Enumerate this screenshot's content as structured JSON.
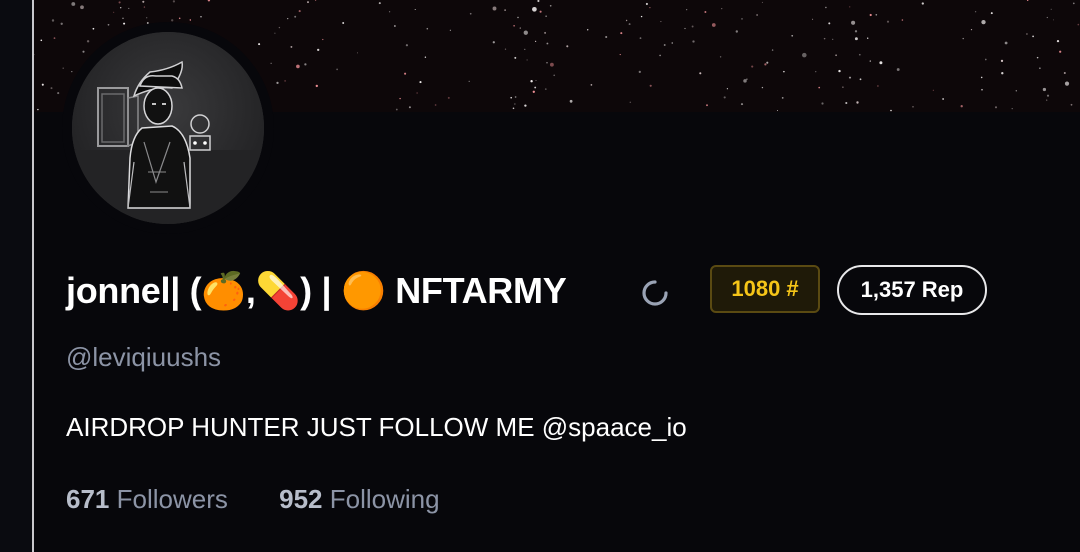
{
  "profile": {
    "display_name": "jonnel| (🍊,💊) | 🟠 NFTARMY",
    "handle": "@leviqiuushs",
    "bio": "AIRDROP HUNTER JUST FOLLOW ME @spaace_io",
    "rank": "1080",
    "rank_symbol": "#",
    "rep": "1,357 Rep",
    "followers_count": "671",
    "followers_label": "Followers",
    "following_count": "952",
    "following_label": "Following"
  },
  "icons": {
    "status": "loading-spinner-icon",
    "avatar": "avatar-image"
  },
  "colors": {
    "background": "#07070b",
    "rank_gold": "#f5c518",
    "muted_text": "#8c94a6",
    "primary_text": "#ffffff"
  }
}
